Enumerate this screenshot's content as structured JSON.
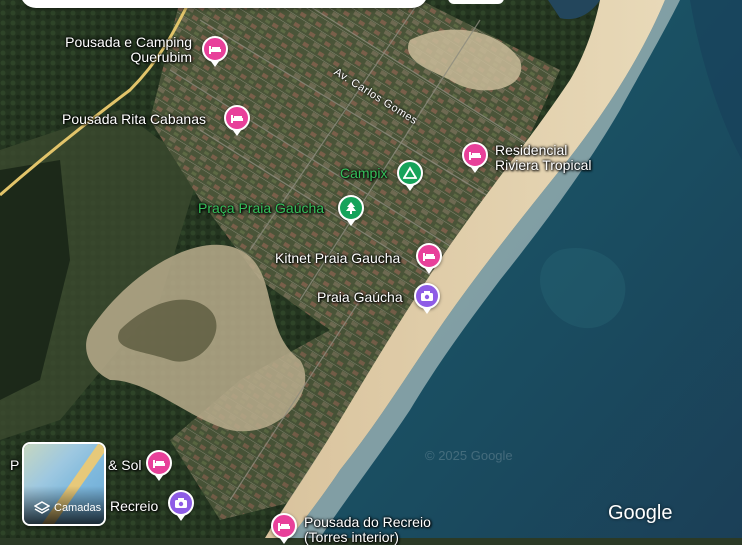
{
  "map": {
    "road_label": "Av. Carlos Gomes",
    "watermark": "© 2025 Google",
    "brand": "Google"
  },
  "layers_button": {
    "label": "Camadas",
    "icon": "layers-icon"
  },
  "places": [
    {
      "label": "Pousada e Camping",
      "label2": "Querubim",
      "type": "lodging",
      "color": "#e8409a",
      "icon": "bed-icon"
    },
    {
      "label": "Pousada Rita Cabanas",
      "type": "lodging",
      "color": "#e8409a",
      "icon": "bed-icon"
    },
    {
      "label": "Residencial",
      "label2": "Riviera Tropical",
      "type": "lodging",
      "color": "#e8409a",
      "icon": "bed-icon"
    },
    {
      "label": "Campix",
      "type": "campground",
      "color": "#15a35a",
      "icon": "tent-icon"
    },
    {
      "label": "Praça Praia Gaúcha",
      "type": "park",
      "color": "#15a35a",
      "icon": "tree-icon"
    },
    {
      "label": "Kitnet Praia Gaucha",
      "type": "lodging",
      "color": "#e8409a",
      "icon": "bed-icon"
    },
    {
      "label": "Praia Gaúcha",
      "type": "attraction",
      "color": "#8e5ce6",
      "icon": "camera-icon"
    },
    {
      "label": "P",
      "label_end": "& Sol",
      "type": "lodging",
      "color": "#e8409a",
      "icon": "bed-icon"
    },
    {
      "label": "Recreio",
      "type": "attraction",
      "color": "#8e5ce6",
      "icon": "camera-icon"
    },
    {
      "label": "Pousada do Recreio",
      "label2": "(Torres interior)",
      "type": "lodging",
      "color": "#e8409a",
      "icon": "bed-icon"
    }
  ]
}
